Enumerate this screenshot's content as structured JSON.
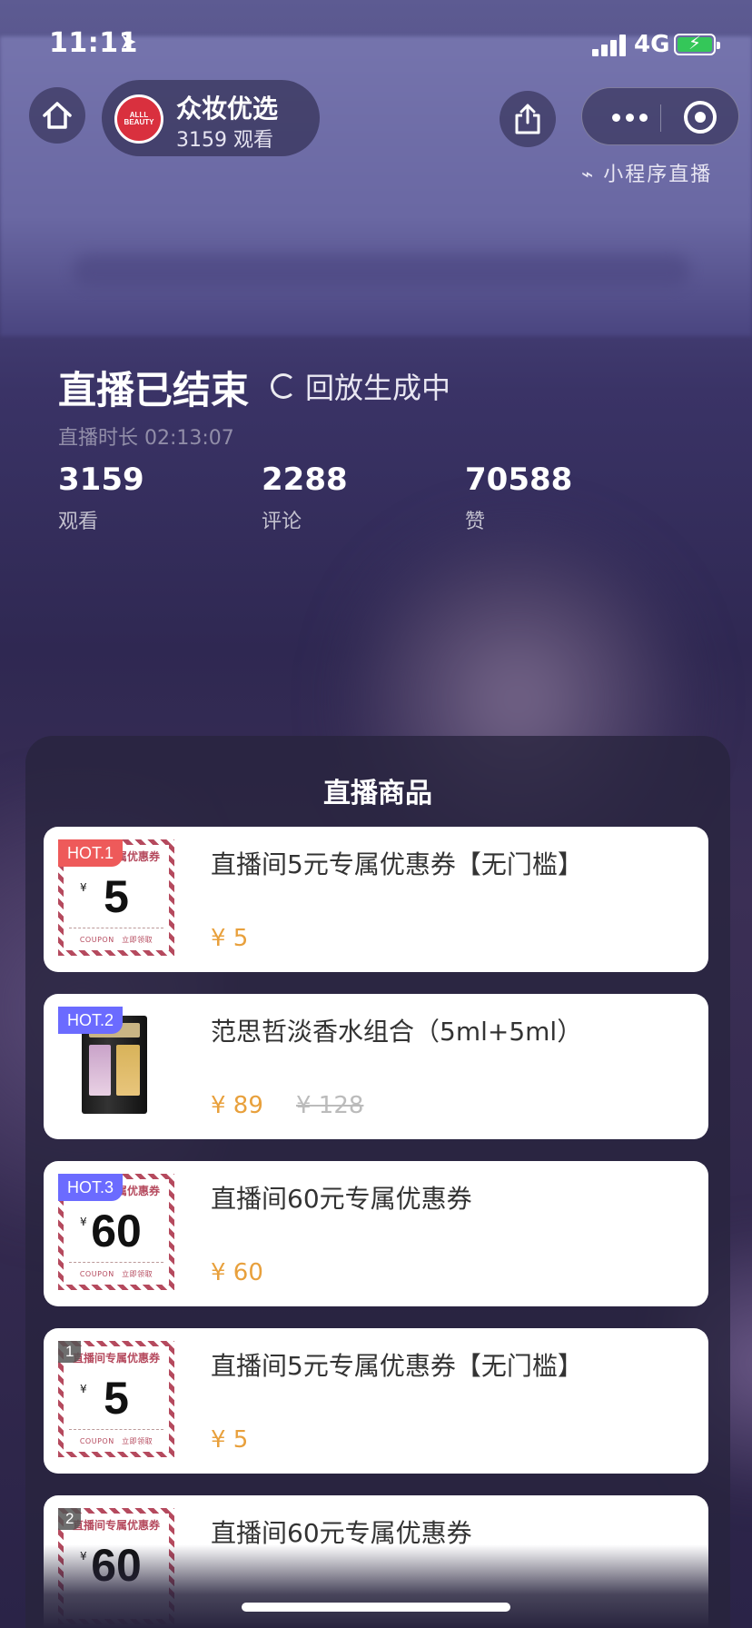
{
  "status_bar": {
    "time": "11:11",
    "network": "4G"
  },
  "header": {
    "anchor_name": "众妆优选",
    "viewers": "3159 观看",
    "logo_text": "ALLL BEAUTY",
    "mini_program_live": "小程序直播"
  },
  "ended": {
    "title": "直播已结束",
    "replay": "回放生成中",
    "duration": "直播时长 02:13:07",
    "stats": [
      {
        "value": "3159",
        "label": "观看"
      },
      {
        "value": "2288",
        "label": "评论"
      },
      {
        "value": "70588",
        "label": "赞"
      }
    ]
  },
  "products": {
    "title": "直播商品",
    "items": [
      {
        "badge": "HOT.1",
        "title": "直播间5元专属优惠券【无门槛】",
        "price": "¥ 5",
        "orig": "",
        "coupon_amount": "5",
        "coupon_header": "直播间专属优惠券",
        "coupon_footer": "COUPON　立即领取"
      },
      {
        "badge": "HOT.2",
        "title": "范思哲淡香水组合（5ml+5ml）",
        "price": "¥ 89",
        "orig": "¥ 128"
      },
      {
        "badge": "HOT.3",
        "title": "直播间60元专属优惠券",
        "price": "¥ 60",
        "orig": "",
        "coupon_amount": "60",
        "coupon_header": "直播间专属优惠券",
        "coupon_footer": "COUPON　立即领取"
      },
      {
        "badge": "1",
        "title": "直播间5元专属优惠券【无门槛】",
        "price": "¥ 5",
        "orig": "",
        "coupon_amount": "5",
        "coupon_header": "直播间专属优惠券",
        "coupon_footer": "COUPON　立即领取"
      },
      {
        "badge": "2",
        "title": "直播间60元专属优惠券",
        "price": "",
        "orig": "",
        "coupon_amount": "60",
        "coupon_header": "直播间专属优惠券",
        "coupon_footer": ""
      }
    ]
  },
  "colors": {
    "price": "#e8a03c",
    "hot_red": "#ee5a5a",
    "hot_blue": "#6b6bff",
    "battery": "#34c759"
  }
}
